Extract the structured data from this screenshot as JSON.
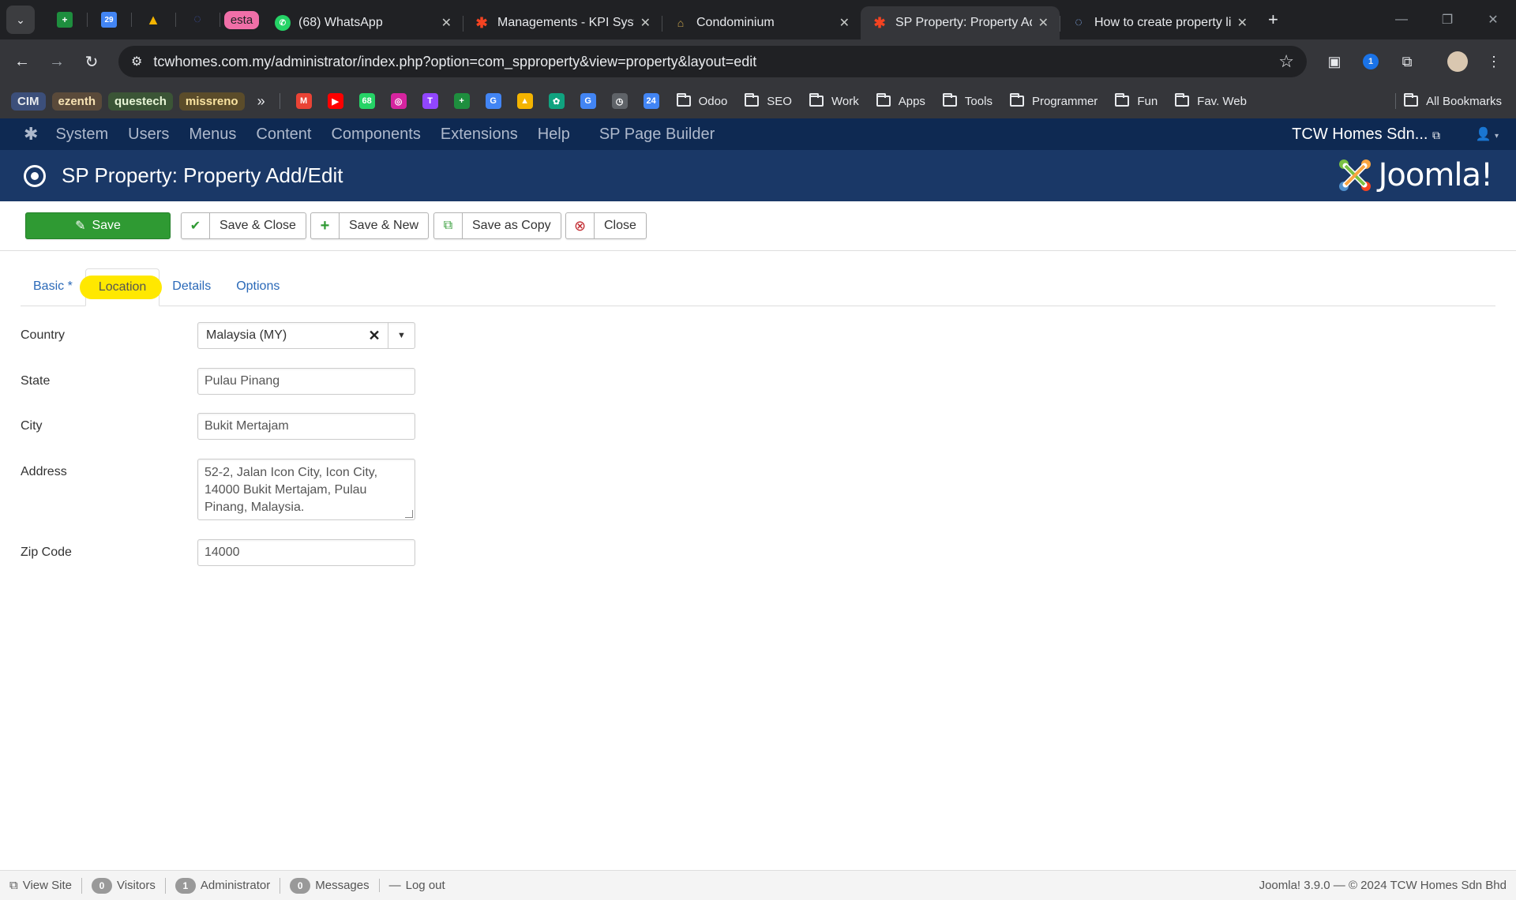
{
  "browser": {
    "pinned": [
      {
        "name": "sheets",
        "glyph": "+",
        "color": "#1e8e3e"
      },
      {
        "name": "calendar",
        "glyph": "29",
        "color": "#4285f4"
      },
      {
        "name": "drive",
        "glyph": "▲",
        "color": "#f4b400"
      },
      {
        "name": "loading",
        "glyph": "◌",
        "color": "#202124"
      },
      {
        "name": "esta",
        "label": "esta"
      }
    ],
    "tabs": [
      {
        "title": "(68) WhatsApp",
        "icon": "whatsapp-icon",
        "color": "#25d366",
        "active": false
      },
      {
        "title": "Managements - KPI System",
        "icon": "joomla-icon",
        "color": "#f44321",
        "active": false
      },
      {
        "title": "Condominium",
        "icon": "condo-icon",
        "color": "#c9a44d",
        "active": false
      },
      {
        "title": "SP Property: Property Add/Edit",
        "icon": "joomla-icon",
        "color": "#f44321",
        "active": true
      },
      {
        "title": "How to create property listing",
        "icon": "loading-icon",
        "color": "#8ab4f8",
        "active": false
      }
    ],
    "url": "tcwhomes.com.my/administrator/index.php?option=com_spproperty&view=property&layout=edit",
    "bookmarks": {
      "pills": [
        {
          "label": "CIM",
          "bg": "#3c4f7a",
          "fg": "#e8eaed"
        },
        {
          "label": "ezenth",
          "bg": "#5a4a3a",
          "fg": "#f6e2b3"
        },
        {
          "label": "questech",
          "bg": "#3b5536",
          "fg": "#e7f5d6"
        },
        {
          "label": "missreno",
          "bg": "#5b4c2a",
          "fg": "#f9e3a0"
        }
      ],
      "overflow": "»",
      "icons": [
        {
          "name": "gmail",
          "glyph": "M",
          "color": "#ea4335"
        },
        {
          "name": "youtube",
          "glyph": "▶",
          "color": "#ff0000"
        },
        {
          "name": "whatsapp",
          "glyph": "68",
          "color": "#25d366"
        },
        {
          "name": "instagram",
          "glyph": "◎",
          "color": "#d6249f"
        },
        {
          "name": "twitch",
          "glyph": "T",
          "color": "#9146ff"
        },
        {
          "name": "sheets",
          "glyph": "+",
          "color": "#1e8e3e"
        },
        {
          "name": "google",
          "glyph": "G",
          "color": "#4285f4"
        },
        {
          "name": "drive",
          "glyph": "▲",
          "color": "#f4b400"
        },
        {
          "name": "chatgpt",
          "glyph": "✿",
          "color": "#10a37f"
        },
        {
          "name": "translate",
          "glyph": "G",
          "color": "#4285f4"
        },
        {
          "name": "timer",
          "glyph": "◷",
          "color": "#5f6368"
        },
        {
          "name": "calendar",
          "glyph": "24",
          "color": "#4285f4"
        }
      ],
      "folders": [
        "Odoo",
        "SEO",
        "Work",
        "Apps",
        "Tools",
        "Programmer",
        "Fun",
        "Fav. Web"
      ],
      "all_bookmarks": "All Bookmarks"
    }
  },
  "admin_nav": {
    "menu": [
      "System",
      "Users",
      "Menus",
      "Content",
      "Components",
      "Extensions",
      "Help",
      "SP Page Builder"
    ],
    "site_name": "TCW Homes Sdn...",
    "user_icon": "user-icon"
  },
  "header": {
    "title": "SP Property: Property Add/Edit",
    "brand": "Joomla!",
    "colors": {
      "nav_bg": "#0e2952",
      "header_bg": "#1a3867"
    }
  },
  "toolbar": {
    "save": "Save",
    "save_close": "Save & Close",
    "save_new": "Save & New",
    "save_copy": "Save as Copy",
    "close": "Close",
    "save_color": "#2f9a33"
  },
  "tabs": [
    {
      "label": "Basic *",
      "active": false
    },
    {
      "label": "Location",
      "active": true,
      "highlighted": true
    },
    {
      "label": "Details",
      "active": false
    },
    {
      "label": "Options",
      "active": false
    }
  ],
  "form": {
    "country": {
      "label": "Country",
      "value": "Malaysia (MY)"
    },
    "state": {
      "label": "State",
      "value": "Pulau Pinang"
    },
    "city": {
      "label": "City",
      "value": "Bukit Mertajam"
    },
    "address": {
      "label": "Address",
      "value": "52-2, Jalan Icon City, Icon City,\n14000 Bukit Mertajam, Pulau\nPinang, Malaysia."
    },
    "zip": {
      "label": "Zip Code",
      "value": "14000"
    }
  },
  "statusbar": {
    "view_site": "View Site",
    "visitors_count": "0",
    "visitors": "Visitors",
    "admin_count": "1",
    "admin": "Administrator",
    "messages_count": "0",
    "messages": "Messages",
    "logout": "Log out",
    "copyright": "Joomla! 3.9.0  —  © 2024 TCW Homes Sdn Bhd"
  }
}
